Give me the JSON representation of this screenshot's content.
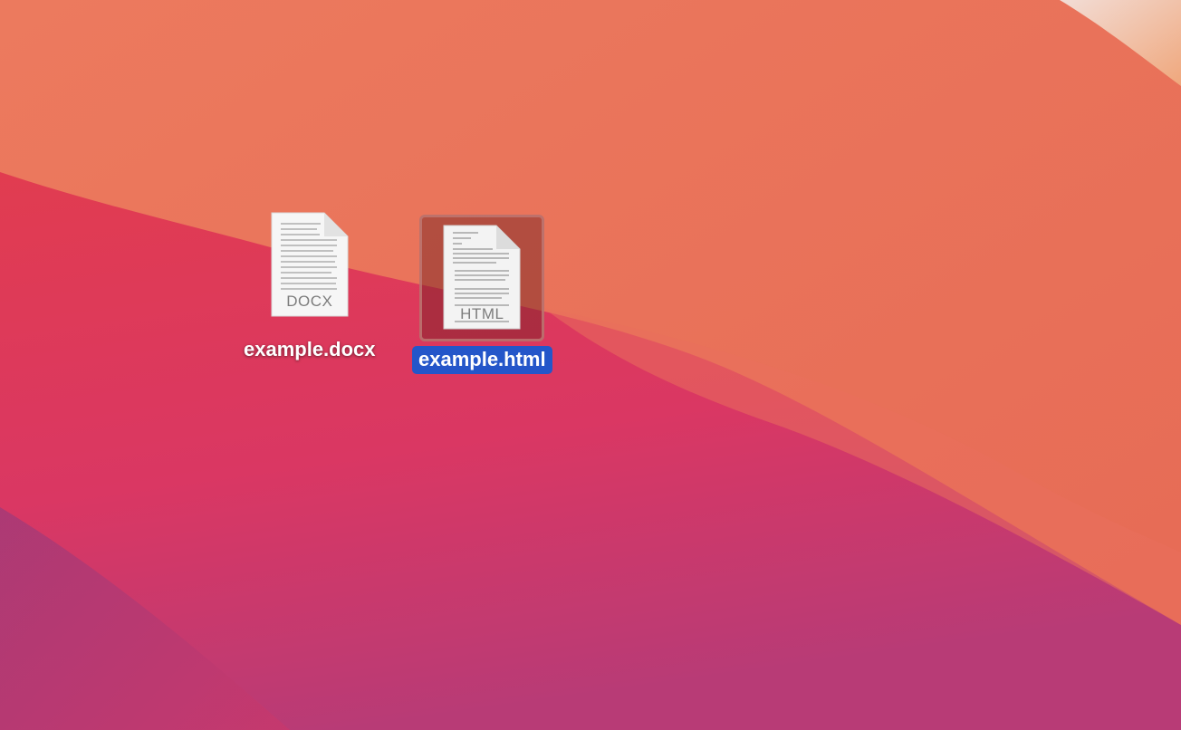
{
  "desktop": {
    "files": [
      {
        "name": "example.docx",
        "type_label": "DOCX",
        "icon": "docx-file-icon",
        "selected": false
      },
      {
        "name": "example.html",
        "type_label": "HTML",
        "icon": "html-file-icon",
        "selected": true
      }
    ]
  },
  "colors": {
    "selection_label_bg": "#2456c9",
    "wallpaper_orange": "#e9705a",
    "wallpaper_red": "#e1454f",
    "wallpaper_magenta": "#d9365e",
    "wallpaper_purple": "#8a3a7c"
  }
}
